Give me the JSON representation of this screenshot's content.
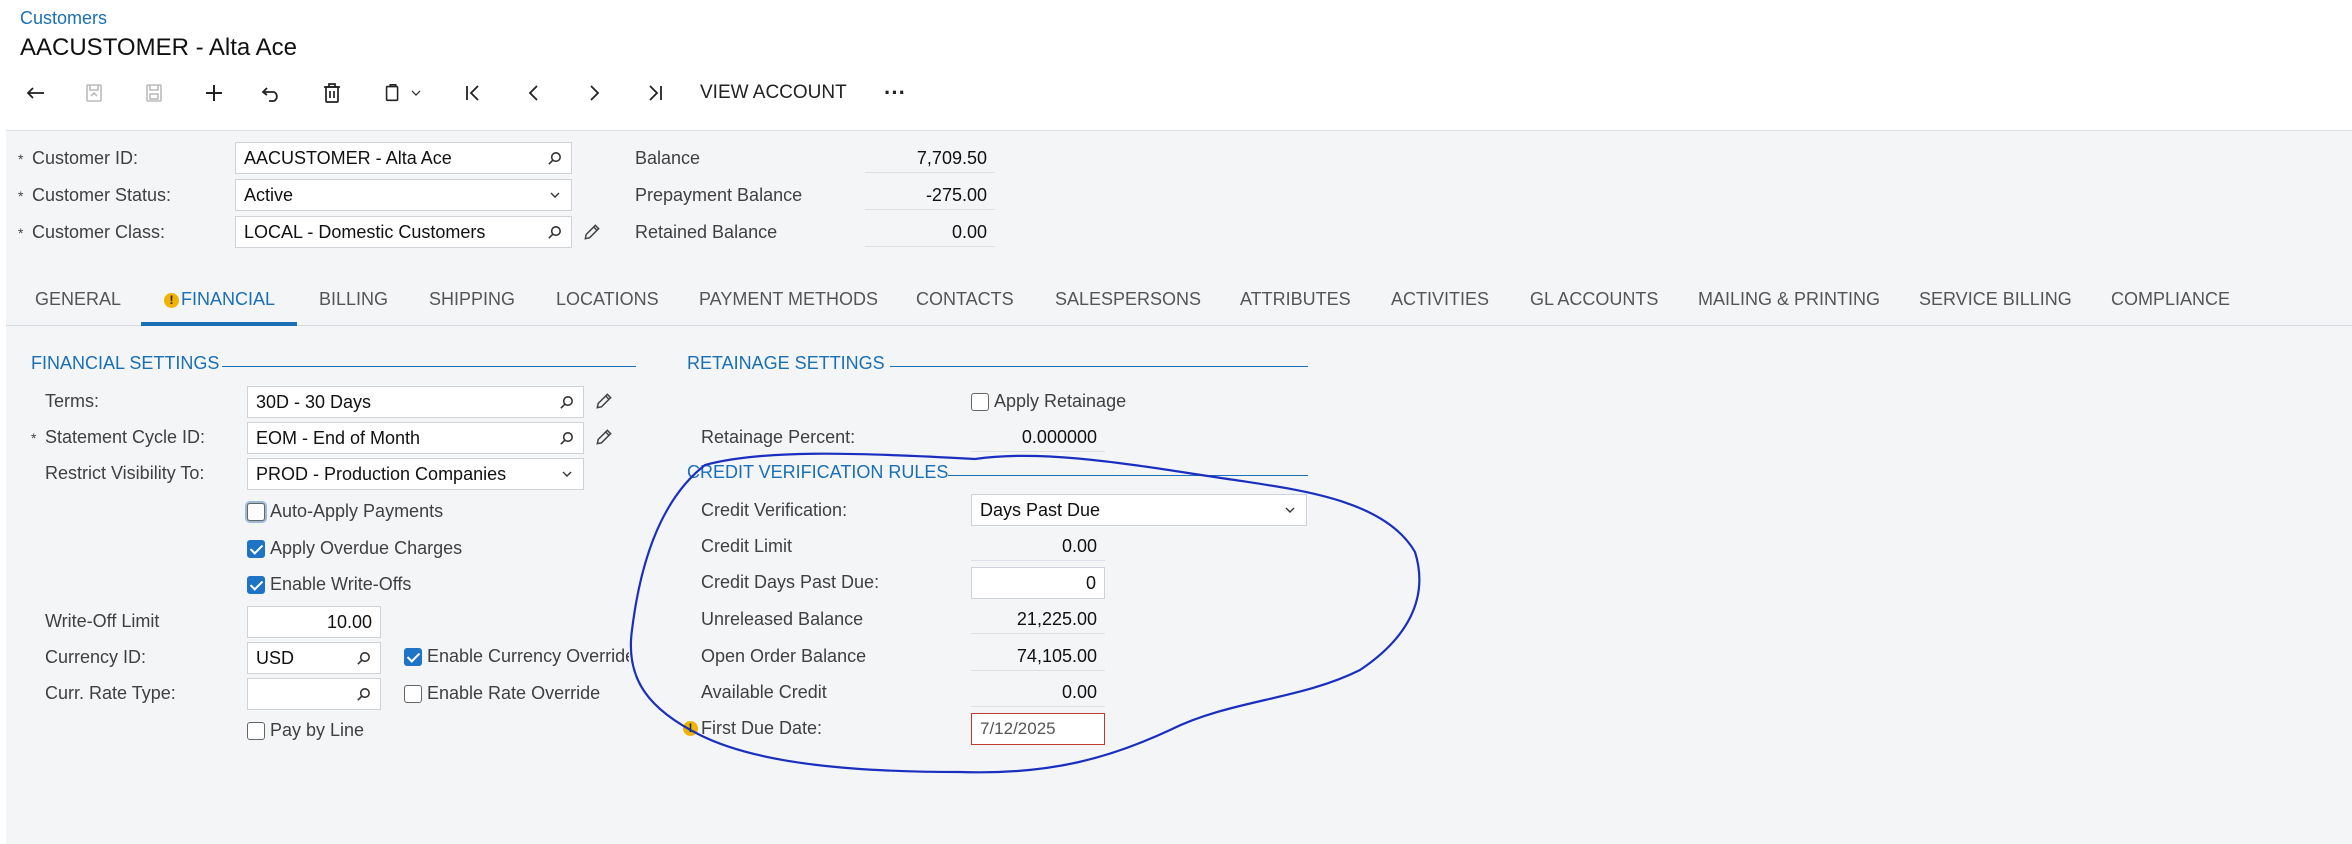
{
  "breadcrumb": "Customers",
  "title": "AACUSTOMER - Alta Ace",
  "toolbar": {
    "view_account": "VIEW ACCOUNT",
    "more": "···"
  },
  "header": {
    "customer_id_label": "Customer ID:",
    "customer_id_value": "AACUSTOMER - Alta Ace",
    "customer_status_label": "Customer Status:",
    "customer_status_value": "Active",
    "customer_class_label": "Customer Class:",
    "customer_class_value": "LOCAL - Domestic Customers",
    "balance_label": "Balance",
    "balance_value": "7,709.50",
    "prepayment_label": "Prepayment Balance",
    "prepayment_value": "-275.00",
    "retained_label": "Retained Balance",
    "retained_value": "0.00",
    "required_mark": "*"
  },
  "tabs": [
    "GENERAL",
    "FINANCIAL",
    "BILLING",
    "SHIPPING",
    "LOCATIONS",
    "PAYMENT METHODS",
    "CONTACTS",
    "SALESPERSONS",
    "ATTRIBUTES",
    "ACTIVITIES",
    "GL ACCOUNTS",
    "MAILING & PRINTING",
    "SERVICE BILLING",
    "COMPLIANCE"
  ],
  "active_tab": "FINANCIAL",
  "financial": {
    "section_title": "FINANCIAL SETTINGS",
    "terms_label": "Terms:",
    "terms_value": "30D - 30 Days",
    "statement_cycle_label": "Statement Cycle ID:",
    "statement_cycle_value": "EOM - End of Month",
    "restrict_label": "Restrict Visibility To:",
    "restrict_value": "PROD - Production Companies",
    "auto_apply_label": "Auto-Apply Payments",
    "auto_apply_checked": false,
    "overdue_label": "Apply Overdue Charges",
    "overdue_checked": true,
    "writeoffs_label": "Enable Write-Offs",
    "writeoffs_checked": true,
    "writeoff_limit_label": "Write-Off Limit",
    "writeoff_limit_value": "10.00",
    "currency_label": "Currency ID:",
    "currency_value": "USD",
    "currency_override_label": "Enable Currency Override",
    "currency_override_checked": true,
    "rate_type_label": "Curr. Rate Type:",
    "rate_type_value": "",
    "rate_override_label": "Enable Rate Override",
    "rate_override_checked": false,
    "pay_by_line_label": "Pay by Line",
    "pay_by_line_checked": false
  },
  "retainage": {
    "section_title": "RETAINAGE SETTINGS",
    "apply_label": "Apply Retainage",
    "apply_checked": false,
    "percent_label": "Retainage Percent:",
    "percent_value": "0.000000"
  },
  "credit": {
    "section_title": "CREDIT VERIFICATION RULES",
    "verification_label": "Credit Verification:",
    "verification_value": "Days Past Due",
    "limit_label": "Credit Limit",
    "limit_value": "0.00",
    "days_label": "Credit Days Past Due:",
    "days_value": "0",
    "unreleased_label": "Unreleased Balance",
    "unreleased_value": "21,225.00",
    "open_order_label": "Open Order Balance",
    "open_order_value": "74,105.00",
    "available_label": "Available Credit",
    "available_value": "0.00",
    "first_due_label": "First Due Date:",
    "first_due_value": "7/12/2025"
  },
  "colors": {
    "accent": "#1a6fb5",
    "annotation": "#1a2fbf",
    "warning": "#f0b400",
    "error_border": "#c0392b"
  }
}
